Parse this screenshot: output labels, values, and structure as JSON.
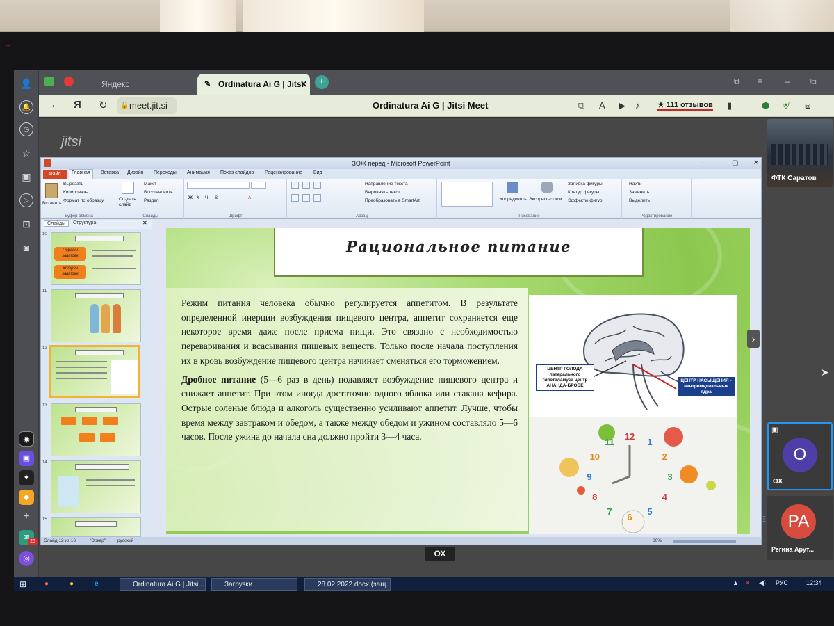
{
  "browser": {
    "tabs": [
      {
        "label": "Яндекс",
        "active": false
      },
      {
        "label": "Ordinatura Ai G | Jitsi",
        "active": true
      }
    ],
    "new_tab_glyph": "+",
    "url": "meet.jit.si",
    "page_title": "Ordinatura Ai G | Jitsi Meet",
    "reviews": "★ 111 отзывов"
  },
  "jitsi": {
    "logo": "jitsi",
    "speaker_label": "ОХ",
    "participants": [
      {
        "name": "ФТК Саратов",
        "type": "video"
      },
      {
        "name": "ОХ",
        "initial": "О",
        "avatar_color": "#4e3fa8"
      },
      {
        "name": "Регина Арут...",
        "initial": "РА",
        "avatar_color": "#d84b3f"
      }
    ]
  },
  "powerpoint": {
    "window_title": "ЗОЖ перед - Microsoft PowerPoint",
    "file_tab": "Файл",
    "tabs": [
      "Главная",
      "Вставка",
      "Дизайн",
      "Переходы",
      "Анимация",
      "Показ слайдов",
      "Рецензирование",
      "Вид"
    ],
    "ribbon": {
      "clipboard": {
        "paste": "Вставить",
        "cut": "Вырезать",
        "copy": "Копировать",
        "format": "Формат по образцу",
        "name": "Буфер обмена"
      },
      "slides": {
        "new_slide": "Создать слайд",
        "layout": "Макет",
        "reset": "Восстановить",
        "section": "Раздел",
        "name": "Слайды"
      },
      "font": {
        "name": "Шрифт"
      },
      "paragraph": {
        "direction": "Направление текста",
        "align": "Выровнять текст",
        "smartart": "Преобразовать в SmartArt",
        "name": "Абзац"
      },
      "drawing": {
        "arrange": "Упорядочить",
        "styles": "Экспресс-стили",
        "fill": "Заливка фигуры",
        "outline": "Контур фигуры",
        "effects": "Эффекты фигур",
        "name": "Рисование"
      },
      "editing": {
        "find": "Найти",
        "replace": "Заменить",
        "select": "Выделить",
        "name": "Редактирование"
      }
    },
    "pane_tabs": [
      "Слайды",
      "Структура"
    ],
    "thumbnails": [
      {
        "num": "10",
        "line1": "Первый",
        "line2": "завтрак",
        "line3": "Второй",
        "line4": "завтрак"
      },
      {
        "num": "11"
      },
      {
        "num": "12",
        "selected": true
      },
      {
        "num": "13"
      },
      {
        "num": "14"
      },
      {
        "num": "15"
      }
    ],
    "status": {
      "slide": "Слайд 12 из 16",
      "theme": "\"Эркер\"",
      "lang": "русский",
      "zoom": "60%"
    }
  },
  "slide": {
    "title": "Рациональное питание",
    "para1": "Режим питания человека обычно регулируется аппетитом. В результате определенной инерции возбуждения пищевого центра, аппетит сохраняется еще некоторое время даже после приема пищи. Это связано с необходимостью переваривания и всасывания пищевых веществ. Только после начала поступления их в кровь возбуждение пищевого центра начинает сменяться его торможением.",
    "para2_bold": "Дробное питание",
    "para2": " (5—6 раз в день) подавляет возбуждение пищевого центра и снижает аппетит. При этом иногда достаточно одного яблока или стакана кефира. Острые соленые блюда и алкоголь существенно усиливают аппетит. Лучше, чтобы время между завтраком и обедом, а также между обедом и ужином составляло 5—6 часов. После ужина до начала сна должно пройти 3—4 часа.",
    "brain_label_left": "ЦЕНТР ГОЛОДА латерального гипоталамуса центр АНАНДА-БРОБЕ",
    "brain_label_right": "ЦЕНТР НАСЫЩЕНИЯ - вентромедиальные ядра",
    "clock_numbers": [
      "12",
      "1",
      "2",
      "3",
      "4",
      "5",
      "6",
      "7",
      "8",
      "9",
      "10",
      "11"
    ]
  },
  "taskbar": {
    "apps": [
      "Ordinatura Ai G | Jitsi...",
      "Загрузки",
      "28.02.2022.docx (защ..."
    ],
    "lang": "РУС",
    "time": "12:34",
    "badge": "25"
  },
  "colors": {
    "accent": "#3fa296",
    "slide_green": "#8cc850",
    "file_tab": "#d24726"
  }
}
